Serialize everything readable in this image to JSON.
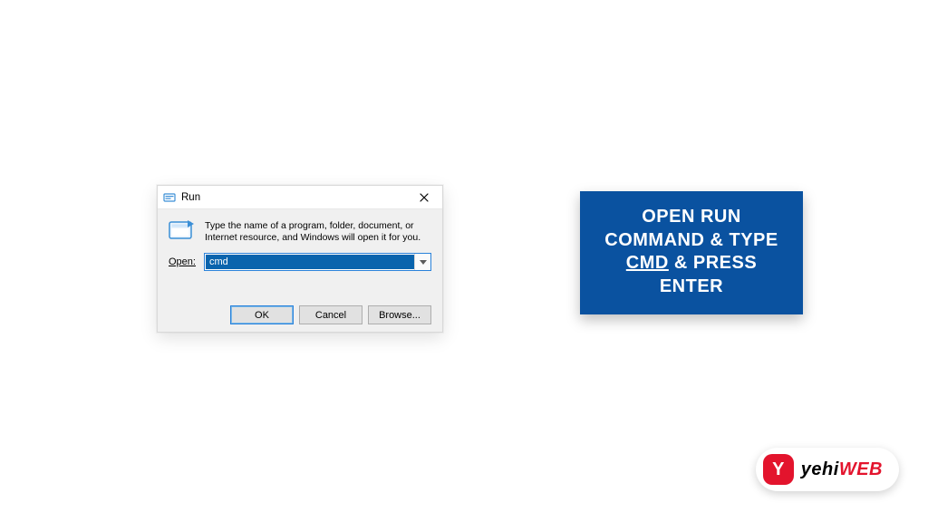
{
  "run_dialog": {
    "title": "Run",
    "description": "Type the name of a program, folder, document, or Internet resource, and Windows will open it for you.",
    "open_label": "Open:",
    "open_value": "cmd",
    "buttons": {
      "ok": "OK",
      "cancel": "Cancel",
      "browse": "Browse..."
    }
  },
  "instruction": {
    "line1": "OPEN RUN",
    "line2": "COMMAND & TYPE",
    "cmd_word": "CMD",
    "line3_suffix": " & PRESS",
    "line4": "ENTER"
  },
  "logo": {
    "mark": "Y",
    "part1": "yehi",
    "part2": "WEB"
  },
  "colors": {
    "card_bg": "#0a52a0",
    "accent_red": "#e3142d",
    "win_selection": "#0a64ad",
    "win_focus_border": "#2a82da"
  }
}
